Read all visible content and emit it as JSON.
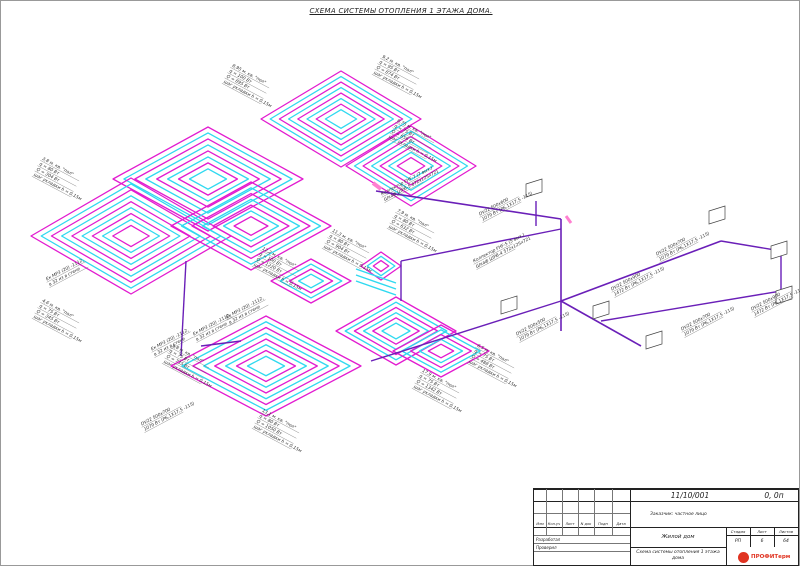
{
  "title": "СХЕМА СИСТЕМЫ ОТОПЛЕНИЯ 1 ЭТАЖА ДОМА.",
  "colors": {
    "pipe_magenta": "#e21bd0",
    "pipe_cyan": "#2fd9f0",
    "supply_purple": "#6a1fb8",
    "manifold_pink": "#ff7fd0"
  },
  "labels": {
    "loop_a": [
      "8,95 м. кв. \"пол\"",
      "q = 100 Вт",
      "Q = 895 Вт",
      "шаг укладки h = 0,15м"
    ],
    "loop_b": [
      "9,2 м. кв. \"пол\"",
      "q = 95 Вт",
      "Q = 874 Вт",
      "шаг укладки h = 0,15м"
    ],
    "loop_c": [
      "8,75 м. кв. \"пол\"",
      "q = 75 Вт",
      "Q = 656 Вт",
      "шаг укладки h = 0,15м"
    ],
    "loop_d": [
      "3,8 м. кв. \"пол\"",
      "q = 80 Вт",
      "Q = 304 Вт",
      "шаг укладки h = 0,15м"
    ],
    "loop_e": [
      "4,6 м. кв. \"пол\"",
      "q = 75 Вт",
      "Q = 345 Вт",
      "шаг укладки h = 0,15м"
    ],
    "loop_f": [
      "13,1 м. кв. \"пол\"",
      "q = 80 Вт",
      "Q = 1050 Вт",
      "шаг укладки h = 0,15м"
    ],
    "loop_g": [
      "9,8 м. кв. \"пол\"",
      "q = 75 Вт",
      "Q = 735 Вт",
      "шаг укладки h = 0,15м"
    ],
    "loop_h": [
      "17,9 м. кв. \"пол\"",
      "q = 75 Вт",
      "Q = 1342 Вт",
      "шаг укладки h = 0,15м"
    ],
    "loop_i": [
      "12,2 м. кв. \"пол\"",
      "q = 100 Вт",
      "Q = 1220 Вт",
      "шаг укладки h = 0,15м"
    ],
    "loop_j": [
      "11,3 м. кв. \"пол\"",
      "q = 80 Вт",
      "Q = 904 Вт",
      "шаг укладки h = 0,15м"
    ],
    "loop_k": [
      "6,5 м. кв. \"пол\"",
      "q = 75 Вт",
      "Q = 488 Вт",
      "шаг укладки h = 0,15м"
    ],
    "loop_l": [
      "7,9 м. кв. \"пол\"",
      "q = 80 Вт",
      "Q = 632 Вт",
      "шаг укладки h = 0,15м"
    ],
    "manifold_1": [
      "Коллектор FHF-7 (7 вых.) ",
      "Шкаф ШРВ-5 672х125х721"
    ],
    "manifold_2": [
      "Коллектор FHF-5 (5 вых.)",
      "Шкаф ШРВ-4 572х125х721"
    ],
    "radiator_1": [
      "DV22 500х600",
      "1079 Вт (Р6,1Х17,5 -115)"
    ],
    "radiator_2": [
      "DV22 500х900",
      "1472 Вт (Р6,1Х17,5 -115)"
    ],
    "radiator_3": [
      "DV22 500х700",
      "1079 Вт (Р6,1Х17,5 -115)"
    ],
    "radiator_4": [
      "DV22 500х900",
      "1472 Вт (Р6,1Х17,5 -115)"
    ],
    "radiator_5": [
      "DV22 500х700",
      "1079 Вт (Р6,1Х17,5 -115)"
    ],
    "radiator_6": [
      "DV22 500х500",
      "1079 Вт (Р6,1Х17,5 -115)"
    ],
    "radiator_7": [
      "DV22 500х700",
      "1079 Вт (Р6,1Х17,5 -115)"
    ],
    "pipe_1": [
      "Ек МР3 (20) -1112,",
      "в 32 из в стене"
    ],
    "pipe_2": [
      "Ек МР3 (20) -1112,",
      "в 32 из в стене"
    ],
    "pipe_3": [
      "Ек МР3 (20) -1112,",
      "в 32 из в стене"
    ],
    "pipe_4": [
      "Ек МР3 (20) -1112,",
      "в 32 из в стене"
    ]
  },
  "stamp": {
    "code": "11/10/001",
    "sheet_code": "0, 0п",
    "customer": "Заказчик: частное лицо",
    "col_headers": [
      "Изм",
      "Кол.уч",
      "Лист",
      "N док",
      "Подп",
      "Дата"
    ],
    "developed": "Разработал",
    "checked": "Проверил",
    "object": "Жилой дом",
    "drawing": "Схема системы отопления 1 этажа дома",
    "stage_header": "Стадия",
    "sheet_header": "Лист",
    "sheets_header": "Листов",
    "stage": "РП",
    "sheet": "6",
    "sheets": "64",
    "company": "ПРОФИТерм"
  }
}
